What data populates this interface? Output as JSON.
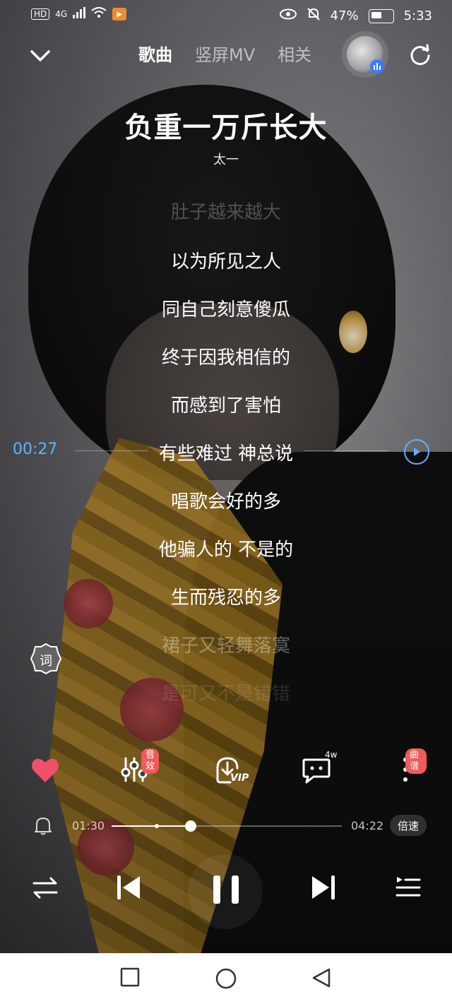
{
  "status_bar": {
    "hd": "HD",
    "network": "4G",
    "battery": "47%",
    "time": "5:33"
  },
  "header": {
    "tabs": [
      {
        "label": "歌曲",
        "active": true
      },
      {
        "label": "竖屏MV",
        "active": false
      },
      {
        "label": "相关",
        "active": false
      }
    ]
  },
  "song": {
    "title": "负重一万斤长大",
    "artist": "太一"
  },
  "lyrics": {
    "lines": [
      "肚子越来越大",
      "以为所见之人",
      "同自己刻意傻瓜",
      "终于因我相信的",
      "而感到了害怕",
      "有些难过 神总说",
      "唱歌会好的多",
      "他骗人的 不是的",
      "生而残忍的多",
      "裙子又轻舞落寞",
      "是可又不是错错"
    ],
    "current_index": 5,
    "current_time": "00:27",
    "lyric_button": "词"
  },
  "actions": {
    "sound_effect_badge": "音效",
    "download_label": "VIP",
    "comment_count": "4w",
    "more_badge": "曲谱"
  },
  "playback": {
    "elapsed": "01:30",
    "total": "04:22",
    "progress_fraction": 0.344,
    "buffer_fraction": 0.195,
    "speed_label": "倍速"
  },
  "colors": {
    "accent": "#5fb2ff",
    "heart": "#f0506a",
    "badge": "#f05a5a"
  }
}
